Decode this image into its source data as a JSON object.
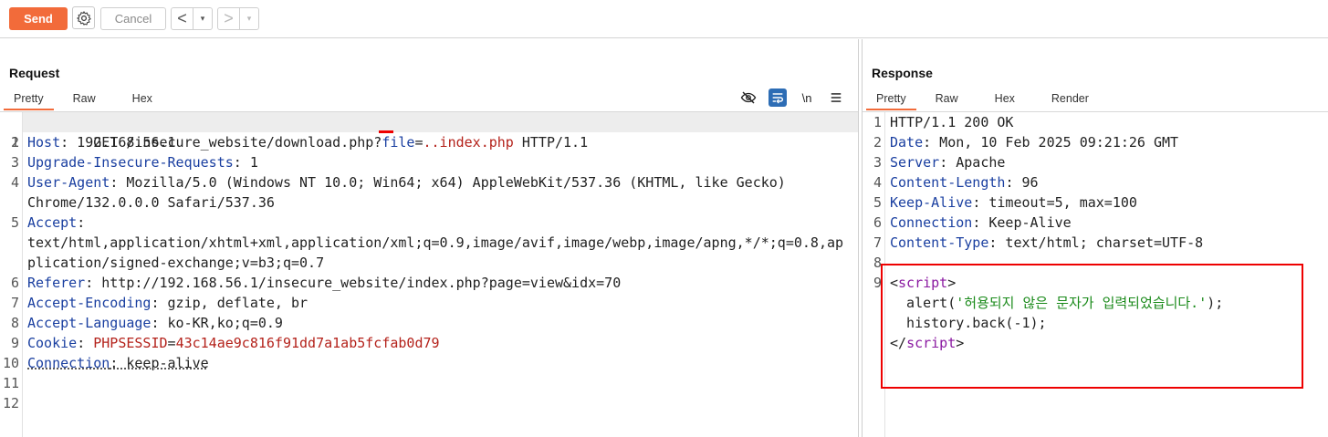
{
  "toolbar": {
    "send_label": "Send",
    "cancel_label": "Cancel",
    "back_arrow": "<",
    "forward_arrow": ">",
    "dropdown_glyph": "▾"
  },
  "request": {
    "title": "Request",
    "tabs": [
      "Pretty",
      "Raw",
      "Hex"
    ],
    "active_tab": "Pretty",
    "tools": [
      "hide-icon",
      "wrap-lines-icon",
      "newline-icon",
      "menu-icon"
    ],
    "newline_label": "\\n",
    "lines": [
      {
        "n": "1",
        "method": "GET /insecure_website/download.php?",
        "param": "file",
        "eq": "=",
        "dots": "..",
        "value": "index.php",
        "proto": " HTTP/1.1"
      },
      {
        "n": "2",
        "key": "Host",
        "val": ": 192.168.56.1"
      },
      {
        "n": "3",
        "key": "Upgrade-Insecure-Requests",
        "val": ": 1"
      },
      {
        "n": "4",
        "key": "User-Agent",
        "val": ": Mozilla/5.0 (Windows NT 10.0; Win64; x64) AppleWebKit/537.36 (KHTML, like Gecko)",
        "cont": "Chrome/132.0.0.0 Safari/537.36"
      },
      {
        "n": "5",
        "key": "Accept",
        "val": ":",
        "cont": "text/html,application/xhtml+xml,application/xml;q=0.9,image/avif,image/webp,image/apng,*/*;q=0.8,ap",
        "cont2": "plication/signed-exchange;v=b3;q=0.7"
      },
      {
        "n": "6",
        "key": "Referer",
        "val": ": http://192.168.56.1/insecure_website/index.php?page=view&idx=70"
      },
      {
        "n": "7",
        "key": "Accept-Encoding",
        "val": ": gzip, deflate, br"
      },
      {
        "n": "8",
        "key": "Accept-Language",
        "val": ": ko-KR,ko;q=0.9"
      },
      {
        "n": "9",
        "key": "Cookie",
        "val": ": ",
        "ckey": "PHPSESSID",
        "ceq": "=",
        "cval": "43c14ae9c816f91dd7a1ab5fcfab0d79"
      },
      {
        "n": "10",
        "key": "Connection",
        "val": ": keep-alive"
      },
      {
        "n": "11"
      },
      {
        "n": "12"
      }
    ]
  },
  "response": {
    "title": "Response",
    "tabs": [
      "Pretty",
      "Raw",
      "Hex",
      "Render"
    ],
    "active_tab": "Pretty",
    "status_line": "HTTP/1.1 200 OK",
    "headers": [
      {
        "n": "2",
        "key": "Date",
        "val": ": Mon, 10 Feb 2025 09:21:26 GMT"
      },
      {
        "n": "3",
        "key": "Server",
        "val": ": Apache"
      },
      {
        "n": "4",
        "key": "Content-Length",
        "val": ": 96"
      },
      {
        "n": "5",
        "key": "Keep-Alive",
        "val": ": timeout=5, max=100"
      },
      {
        "n": "6",
        "key": "Connection",
        "val": ": Keep-Alive"
      },
      {
        "n": "7",
        "key": "Content-Type",
        "val": ": text/html; charset=UTF-8"
      }
    ],
    "body": {
      "open_lt": "<",
      "open_tag": "script",
      "open_gt": ">",
      "alert_pre": "  alert(",
      "alert_str": "'허용되지 않은 문자가 입력되었습니다.'",
      "alert_post": ");",
      "history": "  history.back(-1);",
      "close_lt": "</",
      "close_tag": "script",
      "close_gt": ">"
    }
  },
  "colors": {
    "accent": "#f26b3a",
    "header_key": "#1a3fa0",
    "param_value": "#b4221b",
    "tag": "#8a19a1",
    "string": "#1a8a1a",
    "annotation": "#e00000"
  }
}
